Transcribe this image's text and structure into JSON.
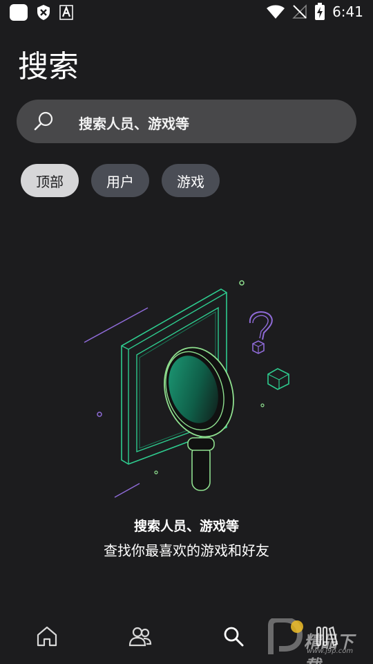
{
  "status_bar": {
    "time": "6:41",
    "icons": [
      "app-square-icon",
      "shield-x-icon",
      "font-a-icon",
      "wifi-icon",
      "no-signal-icon",
      "battery-charging-icon"
    ]
  },
  "page": {
    "title": "搜索"
  },
  "search": {
    "placeholder": "搜索人员、游戏等"
  },
  "chips": [
    {
      "label": "顶部",
      "selected": true
    },
    {
      "label": "用户",
      "selected": false
    },
    {
      "label": "游戏",
      "selected": false
    }
  ],
  "empty_state": {
    "title": "搜索人员、游戏等",
    "subtitle": "查找你最喜欢的游戏和好友",
    "illustration_icon": "magnifier-frame-illustration"
  },
  "bottom_nav": [
    {
      "icon": "home-icon",
      "active": false
    },
    {
      "icon": "friends-icon",
      "active": false
    },
    {
      "icon": "search-icon",
      "active": true
    },
    {
      "icon": "library-icon",
      "active": false
    }
  ],
  "watermark": {
    "text": "精品下载",
    "url": "www.j9p.com"
  },
  "colors": {
    "background": "#1c1c1e",
    "search_bg": "#48484a",
    "chip_active": "#d6d6d8",
    "chip_inactive": "#4a4d55",
    "accent_green": "#2ecc8f",
    "accent_purple": "#8f6bd8"
  }
}
